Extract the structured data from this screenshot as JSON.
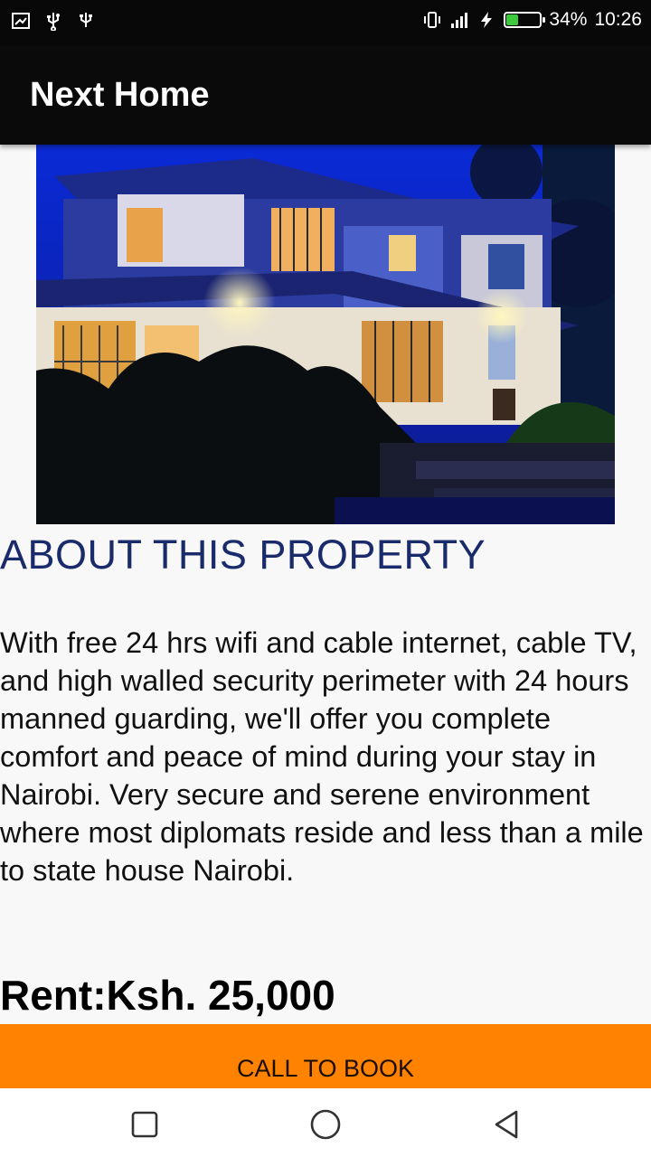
{
  "status_bar": {
    "battery_percent": "34%",
    "battery_level": 0.34,
    "time": "10:26",
    "icons": [
      "screenshot-icon",
      "usb-icon",
      "usb-debug-icon",
      "vibrate-icon",
      "signal-icon",
      "charging-icon",
      "battery-icon"
    ]
  },
  "app_bar": {
    "title": "Next Home"
  },
  "property": {
    "image_alt": "house-photo",
    "section_title": "ABOUT THIS PROPERTY",
    "description": "With free 24 hrs wifi and cable internet, cable TV, and high walled security perimeter with 24 hours manned guarding, we'll offer you complete comfort and peace of mind during your stay in Nairobi. Very secure and serene environment where most diplomats reside and less than a mile to state house Nairobi.",
    "rent": "Rent:Ksh. 25,000"
  },
  "cta": {
    "label": "CALL TO BOOK",
    "color": "#ff8200"
  },
  "nav_bar": {
    "buttons": [
      "recents-square-icon",
      "home-circle-icon",
      "back-triangle-icon"
    ]
  },
  "colors": {
    "status_bar_bg": "#080808",
    "app_bar_bg": "#0a0a0a",
    "title_accent": "#1a2b6b",
    "page_bg": "#f8f8f8"
  }
}
